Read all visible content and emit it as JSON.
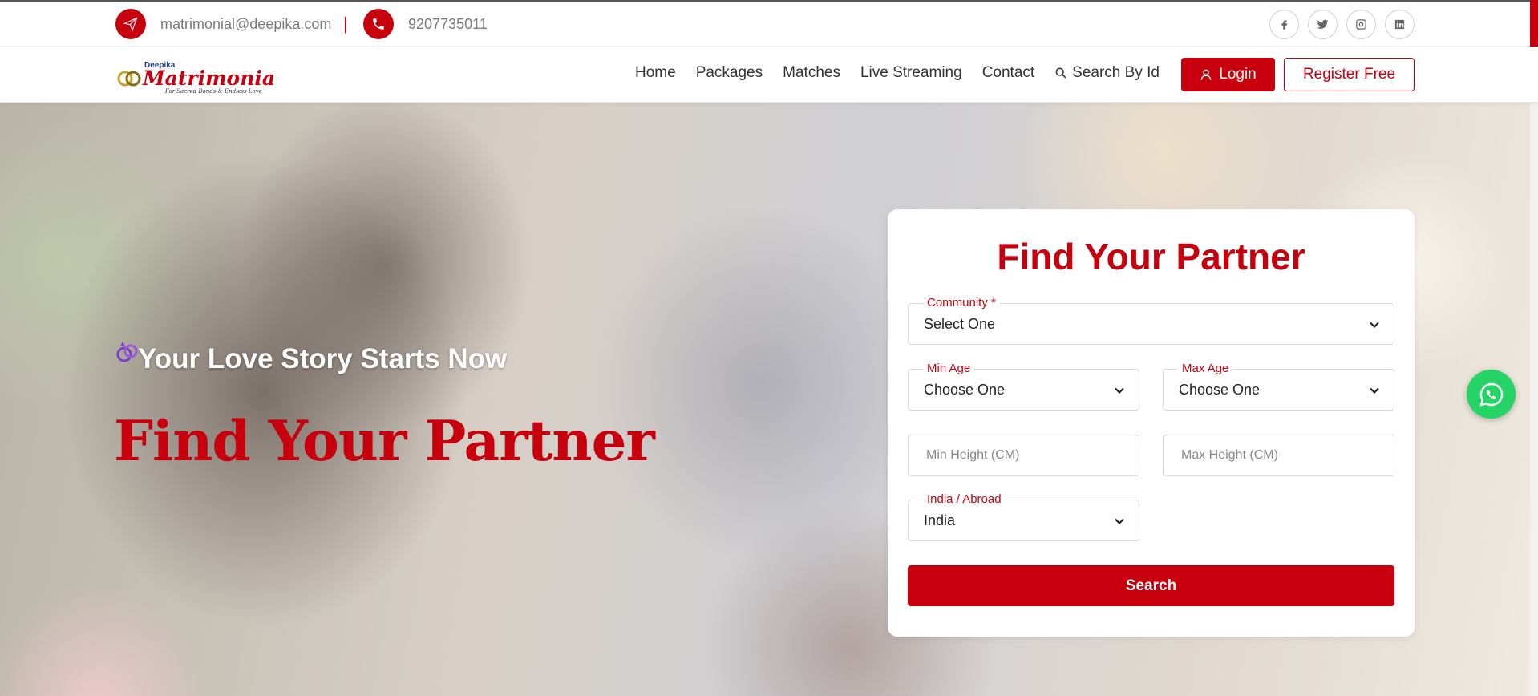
{
  "topbar": {
    "email": "matrimonial@deepika.com",
    "separator": "|",
    "phone": "9207735011",
    "socials": [
      "facebook-icon",
      "twitter-icon",
      "instagram-icon",
      "linkedin-icon"
    ]
  },
  "brand": {
    "small": "Deepika",
    "name": "Matrimonial",
    "tagline": "For Sacred Bonds & Endless Love"
  },
  "nav": {
    "links": [
      "Home",
      "Packages",
      "Matches",
      "Live Streaming",
      "Contact"
    ],
    "search_by_id": "Search By Id",
    "login": "Login",
    "register": "Register Free"
  },
  "hero": {
    "tagline": "Your Love Story Starts Now",
    "title": "Find Your Partner"
  },
  "form": {
    "title": "Find Your Partner",
    "community": {
      "label": "Community",
      "required_mark": "*",
      "value": "Select One"
    },
    "min_age": {
      "label": "Min Age",
      "value": "Choose One"
    },
    "max_age": {
      "label": "Max Age",
      "value": "Choose One"
    },
    "min_height": {
      "placeholder": "Min Height (CM)"
    },
    "max_height": {
      "placeholder": "Max Height (CM)"
    },
    "location": {
      "label": "India / Abroad",
      "value": "India"
    },
    "search_button": "Search"
  },
  "colors": {
    "brand_red": "#c8000d",
    "whatsapp_green": "#25d366"
  }
}
